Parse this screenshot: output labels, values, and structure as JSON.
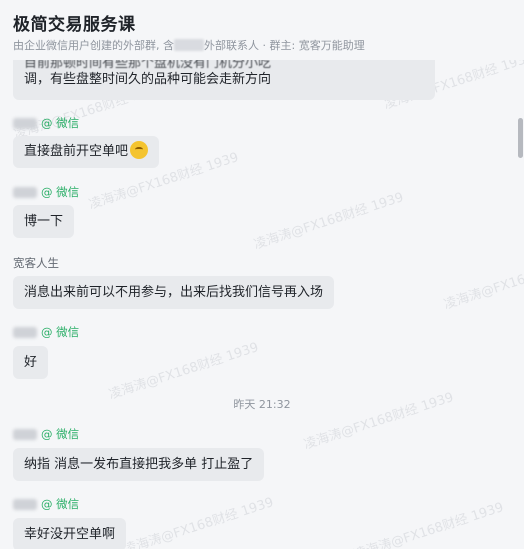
{
  "header": {
    "title": "极简交易服务课",
    "subtitle_prefix": "由企业微信用户创建的外部群, 含",
    "subtitle_suffix": "外部联系人 · 群主: 宽客万能助理"
  },
  "watermark": "凌海涛@FX168财经 1939",
  "messages": [
    {
      "sender_tag": "",
      "text": "调，有些盘整时间久的品种可能会走新方向",
      "partial_top": "目前那顿时间有些那个盘机没有门机分小吃"
    },
    {
      "sender_tag": "@ 微信",
      "text": "直接盘前开空单吧",
      "emoji": "thinking-face"
    },
    {
      "sender_tag": "@ 微信",
      "text": "博一下"
    },
    {
      "sender_name": "宽客人生",
      "text": "消息出来前可以不用参与，出来后找我们信号再入场"
    },
    {
      "sender_tag": "@ 微信",
      "text": "好"
    },
    {
      "sender_tag": "@ 微信",
      "text": "纳指 消息一发布直接把我多单 打止盈了"
    },
    {
      "sender_tag": "@ 微信",
      "text": "幸好没开空单啊"
    }
  ],
  "timestamp": "昨天 21:32"
}
